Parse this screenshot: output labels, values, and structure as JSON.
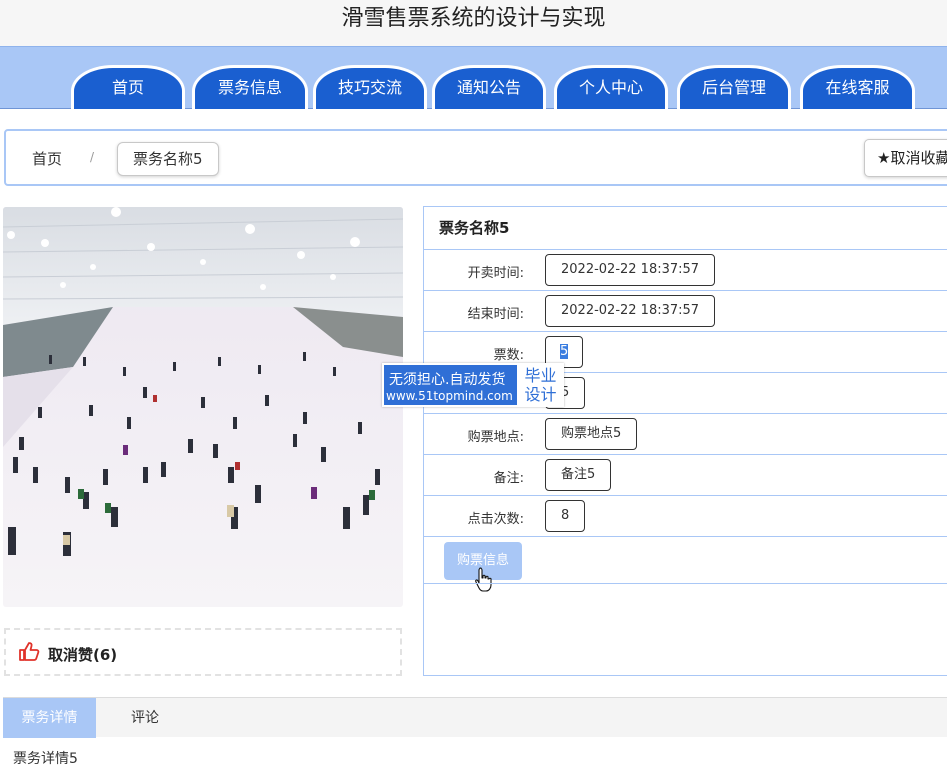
{
  "site": {
    "title": "滑雪售票系统的设计与实现"
  },
  "nav": {
    "items": [
      {
        "label": "首页"
      },
      {
        "label": "票务信息"
      },
      {
        "label": "技巧交流"
      },
      {
        "label": "通知公告"
      },
      {
        "label": "个人中心"
      },
      {
        "label": "后台管理"
      },
      {
        "label": "在线客服"
      }
    ]
  },
  "breadcrumb": {
    "home": "首页",
    "separator": "/",
    "current": "票务名称5",
    "favorite_icon": "★",
    "favorite_label": "取消收藏"
  },
  "like": {
    "label": "取消赞(6)",
    "icon": "thumbs-up-icon"
  },
  "ticket": {
    "name": "票务名称5",
    "rows": [
      {
        "label": "开卖时间:",
        "value": "2022-02-22 18:37:57"
      },
      {
        "label": "结束时间:",
        "value": "2022-02-22 18:37:57"
      },
      {
        "label": "票数:",
        "value": "5"
      },
      {
        "label": "",
        "value": "5"
      },
      {
        "label": "购票地点:",
        "value": "购票地点5"
      },
      {
        "label": "备注:",
        "value": "备注5"
      },
      {
        "label": "点击次数:",
        "value": "8"
      }
    ],
    "buy_label": "购票信息"
  },
  "watermark": {
    "line1": "无须担心.自动发货",
    "line2": "www.51topmind.com",
    "side_top": "毕业",
    "side_bottom": "设计"
  },
  "detail_tabs": {
    "active": "票务详情",
    "other": "评论"
  },
  "details": {
    "text": "票务详情5"
  },
  "colors": {
    "nav_bg": "#a9c7f6",
    "tab_blue": "#1a5fd0",
    "accent_light": "#a9c7f6",
    "like_red": "#e0332b"
  }
}
